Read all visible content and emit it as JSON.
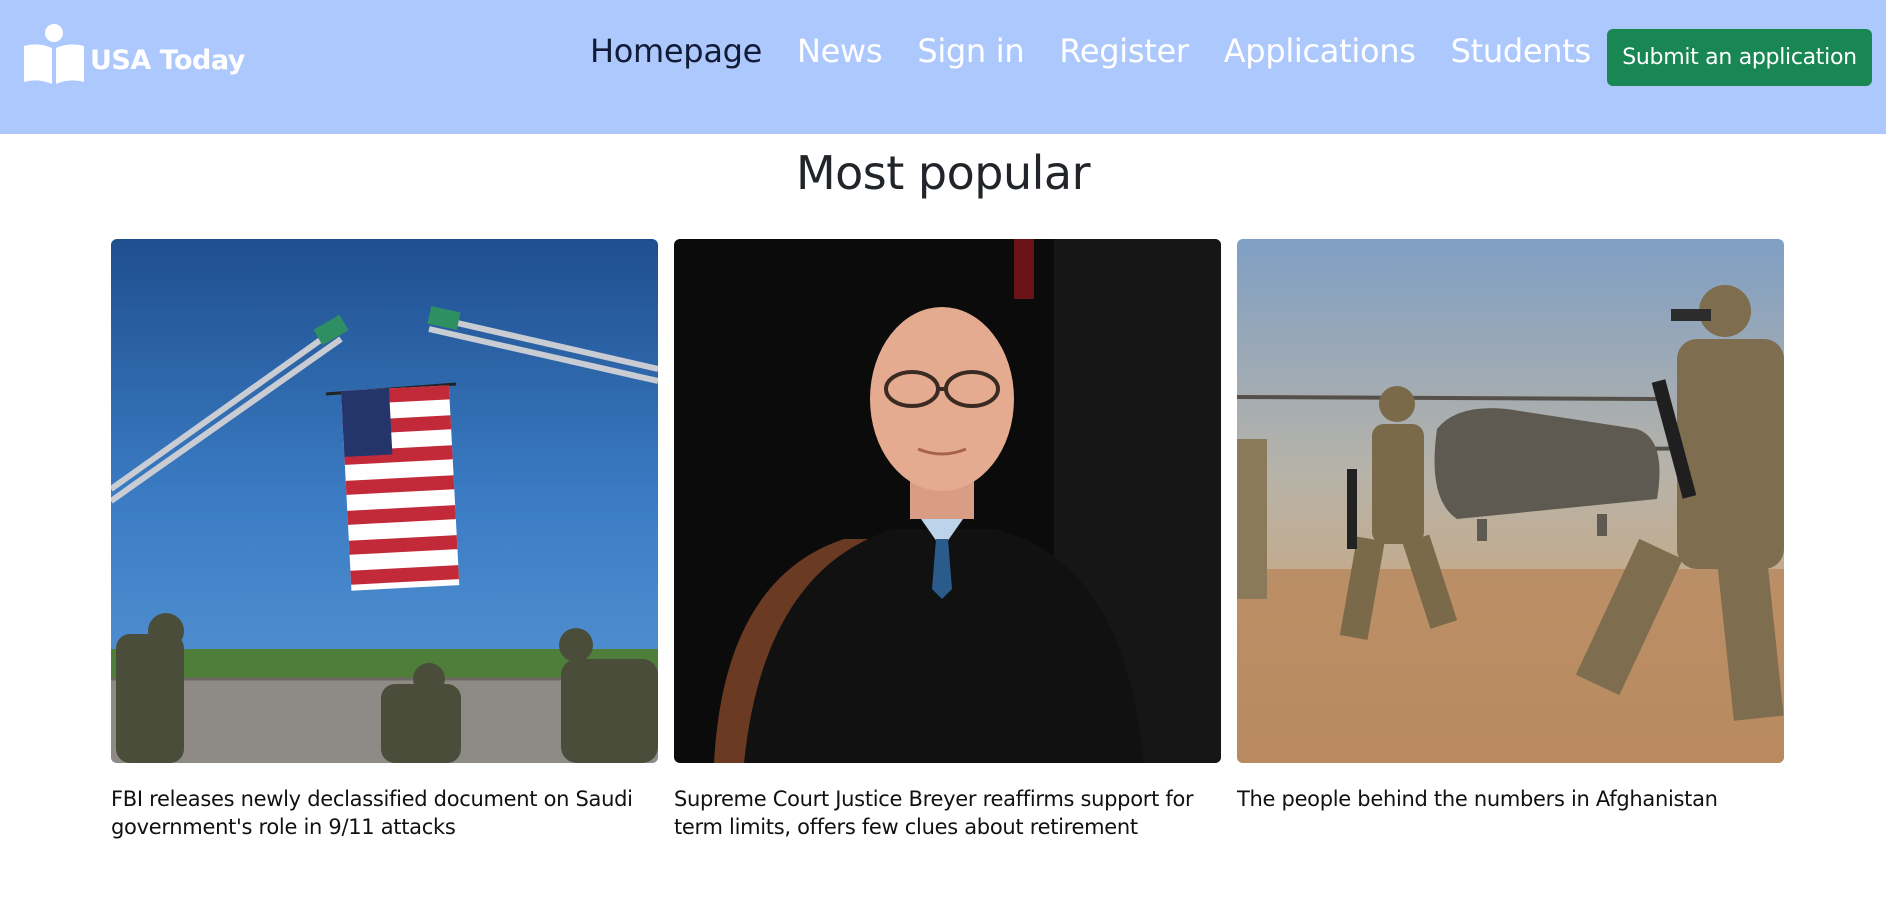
{
  "brand": {
    "name": "USA Today",
    "icon": "book-reader-logo-icon"
  },
  "nav": {
    "items": [
      {
        "label": "Homepage",
        "active": true
      },
      {
        "label": "News",
        "active": false
      },
      {
        "label": "Sign in",
        "active": false
      },
      {
        "label": "Register",
        "active": false
      },
      {
        "label": "Applications",
        "active": false
      },
      {
        "label": "Students",
        "active": false
      }
    ],
    "cta_label": "Submit an application"
  },
  "colors": {
    "navbar_bg": "#adc8fc",
    "nav_active": "#111b36",
    "nav_inactive": "#ffffff",
    "cta_bg": "#198754"
  },
  "main": {
    "section_title": "Most popular",
    "articles": [
      {
        "image": "flag-between-fire-ladders-photo",
        "caption": "FBI releases newly declassified document on Saudi government's role in 9/11 attacks"
      },
      {
        "image": "justice-in-robe-portrait-photo",
        "caption": "Supreme Court Justice Breyer reaffirms support for term limits, offers few clues about retirement"
      },
      {
        "image": "soldiers-helicopter-desert-photo",
        "caption": "The people behind the numbers in Afghanistan"
      }
    ]
  }
}
